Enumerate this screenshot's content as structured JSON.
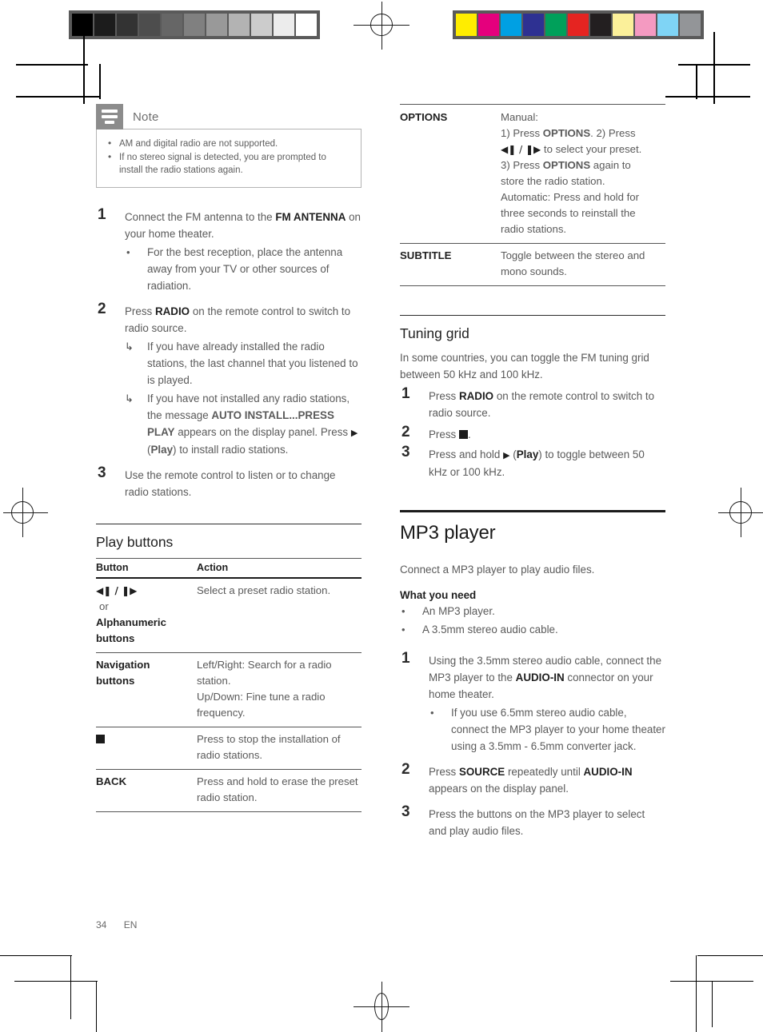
{
  "page": {
    "number": "34",
    "language": "EN"
  },
  "calibration": {
    "gray_strip": [
      "#000000",
      "#1c1c1c",
      "#333333",
      "#4d4d4d",
      "#666666",
      "#808080",
      "#999999",
      "#b3b3b3",
      "#cccccc",
      "#ececec",
      "#ffffff"
    ],
    "color_strip": [
      "#ffed00",
      "#e5007d",
      "#00a0e3",
      "#2e3192",
      "#00a05a",
      "#e52421",
      "#231f20",
      "#fbf09a",
      "#f49ac1",
      "#7fd4f5",
      "#939598"
    ]
  },
  "left_column": {
    "note": {
      "title": "Note",
      "icon": "note-lines-icon",
      "items": [
        "AM and digital radio are not supported.",
        "If no stereo signal is detected, you are prompted to install the radio stations again."
      ]
    },
    "steps": [
      {
        "num": "1",
        "text_parts": [
          {
            "t": "Connect the FM antenna to the ",
            "b": false
          },
          {
            "t": "FM ANTENNA",
            "b": true
          },
          {
            "t": " on your home theater.",
            "b": false
          }
        ],
        "subs": [
          {
            "marker": "bullet",
            "text": "For the best reception, place the antenna away from your TV or other sources of radiation."
          }
        ]
      },
      {
        "num": "2",
        "text_parts": [
          {
            "t": "Press ",
            "b": false
          },
          {
            "t": "RADIO",
            "b": true
          },
          {
            "t": " on the remote control to switch to radio source.",
            "b": false
          }
        ],
        "subs": [
          {
            "marker": "arrow",
            "text": "If you have already installed the radio stations, the last channel that you listened to is played."
          },
          {
            "marker": "arrow",
            "text": "If you have not installed any radio stations, the message AUTO INSTALL...PRESS PLAY appears on the display panel. Press ▶ (Play) to install radio stations."
          }
        ]
      },
      {
        "num": "3",
        "text_parts": [
          {
            "t": "Use the remote control to listen or to change radio stations.",
            "b": false
          }
        ],
        "subs": []
      }
    ],
    "play_buttons": {
      "heading": "Play buttons",
      "columns": [
        "Button",
        "Action"
      ],
      "rows": [
        {
          "button_glyph": "◀❚ / ❚▶",
          "button_or": "or",
          "button_extra": "Alphanumeric buttons",
          "action": "Select a preset radio station."
        },
        {
          "button": "Navigation buttons",
          "action_lines": [
            "Left/Right: Search for a radio station.",
            "Up/Down: Fine tune a radio frequency."
          ]
        },
        {
          "button_icon": "stop-square-icon",
          "action": "Press to stop the installation of radio stations."
        },
        {
          "button": "BACK",
          "action": "Press and hold to erase the preset radio station."
        }
      ]
    }
  },
  "right_column": {
    "options_table": {
      "rows": [
        {
          "key": "OPTIONS",
          "lines": [
            "Manual:",
            "1) Press OPTIONS. 2) Press",
            "◀❚ / ❚▶ to select your preset.",
            "3) Press OPTIONS again to",
            "store the radio station.",
            "Automatic: Press and hold for",
            "three seconds to reinstall the",
            "radio stations."
          ]
        },
        {
          "key": "SUBTITLE",
          "lines": [
            "Toggle between the stereo and mono sounds."
          ]
        }
      ]
    },
    "tuning_grid": {
      "heading": "Tuning grid",
      "intro": "In some countries, you can toggle the FM tuning grid between 50 kHz and 100 kHz.",
      "steps": [
        {
          "num": "1",
          "text": "Press RADIO on the remote control to switch to radio source."
        },
        {
          "num": "2",
          "text": "Press ■."
        },
        {
          "num": "3",
          "text": "Press and hold ▶ (Play) to toggle between 50 kHz or 100 kHz."
        }
      ]
    },
    "mp3": {
      "heading": "MP3 player",
      "intro": "Connect a MP3 player to play audio files.",
      "what_you_need_title": "What you need",
      "what_you_need": [
        "An MP3 player.",
        "A 3.5mm stereo audio cable."
      ],
      "steps": [
        {
          "num": "1",
          "text": "Using the 3.5mm stereo audio cable, connect the MP3 player to the AUDIO-IN connector on your home theater.",
          "subs": [
            "If you use 6.5mm stereo audio cable, connect the MP3 player to your home theater using a 3.5mm - 6.5mm converter jack."
          ]
        },
        {
          "num": "2",
          "text": "Press SOURCE repeatedly until AUDIO-IN appears on the display panel.",
          "subs": []
        },
        {
          "num": "3",
          "text": "Press the buttons on the MP3 player to select and play audio files.",
          "subs": []
        }
      ]
    }
  }
}
